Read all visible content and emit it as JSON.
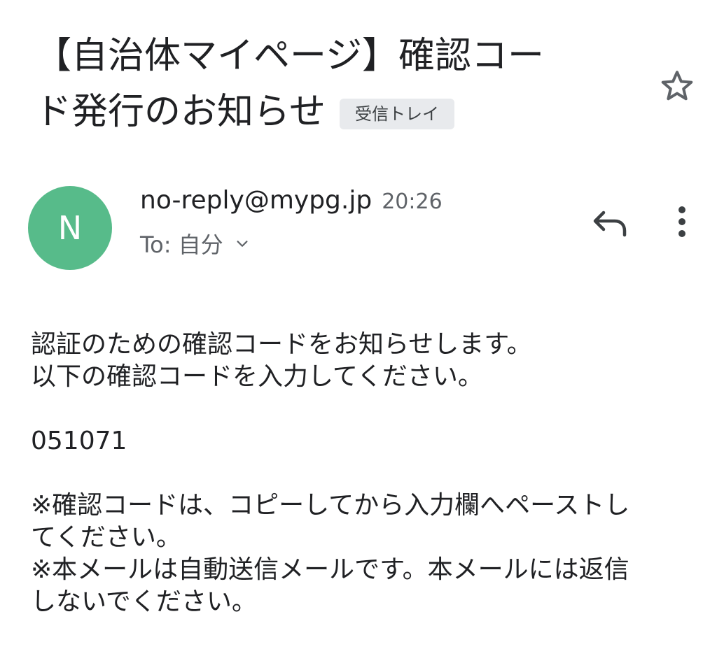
{
  "email": {
    "subject_line1": "【自治体マイページ】確認コー",
    "subject_line2": "ド発行のお知らせ",
    "label": "受信トレイ",
    "sender": {
      "avatar_letter": "N",
      "avatar_color": "#57bb8a",
      "address": "no-reply@mypg.jp",
      "time": "20:26",
      "recipient": "To: 自分"
    },
    "body": {
      "line1": "認証のための確認コードをお知らせします。",
      "line2": "以下の確認コードを入力してください。",
      "code": "051071",
      "note1_line1": "※確認コードは、コピーしてから入力欄へペーストし",
      "note1_line2": "てください。",
      "note2_line1": "※本メールは自動送信メールです。本メールには返信",
      "note2_line2": "しないでください。"
    }
  },
  "icons": {
    "star": "star-outline-icon",
    "reply": "reply-icon",
    "more": "more-vert-icon",
    "chevron": "chevron-down-icon"
  }
}
